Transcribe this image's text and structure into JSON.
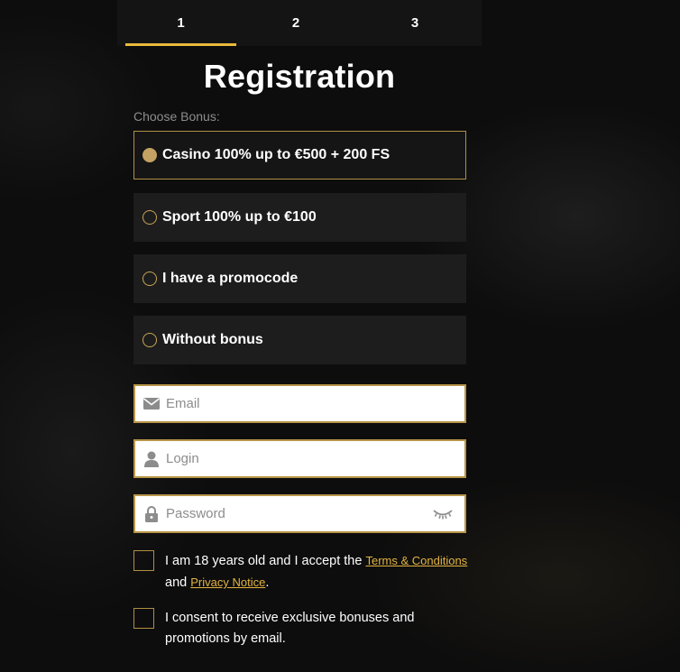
{
  "tabs": [
    {
      "label": "1",
      "active": true
    },
    {
      "label": "2",
      "active": false
    },
    {
      "label": "3",
      "active": false
    }
  ],
  "title": "Registration",
  "choose_bonus_label": "Choose Bonus:",
  "bonuses": [
    {
      "label": "Casino 100% up to €500 + 200 FS",
      "selected": true
    },
    {
      "label": "Sport 100% up to €100",
      "selected": false
    },
    {
      "label": "I have a promocode",
      "selected": false
    },
    {
      "label": "Without bonus",
      "selected": false
    }
  ],
  "fields": {
    "email": {
      "placeholder": "Email",
      "value": "",
      "icon": "envelope-icon"
    },
    "login": {
      "placeholder": "Login",
      "value": "",
      "icon": "user-icon"
    },
    "password": {
      "placeholder": "Password",
      "value": "",
      "icon": "lock-icon"
    }
  },
  "consent_terms": {
    "prefix": "I am 18 years old and I accept the ",
    "terms_link": "Terms & Conditions",
    "middle": "and ",
    "privacy_link": "Privacy Notice",
    "suffix": "."
  },
  "consent_marketing": {
    "text": "I consent to receive exclusive bonuses and promotions by email."
  },
  "colors": {
    "accent": "#e8b93a",
    "border_gold": "#b79549",
    "panel_bg": "#1d1d1d",
    "link": "#e3b441"
  }
}
